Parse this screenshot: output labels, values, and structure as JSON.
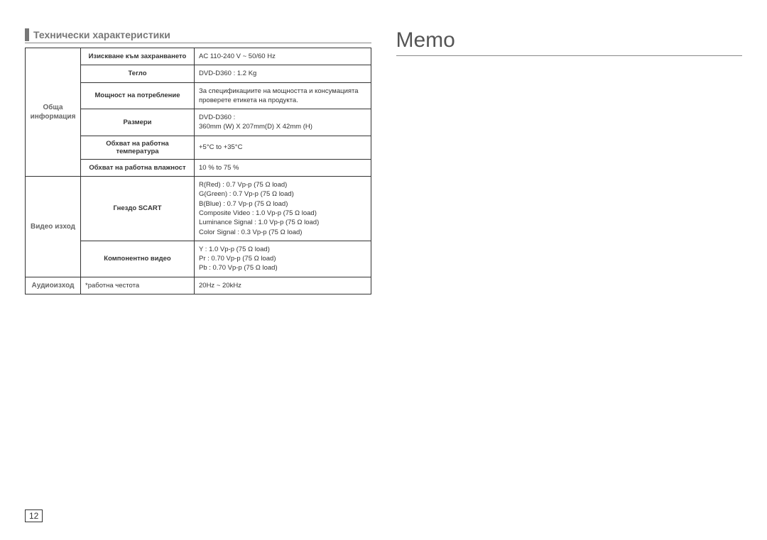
{
  "section_title": "Технически характеристики",
  "memo_title": "Memo",
  "page_number": "12",
  "groups": [
    {
      "head": "Обща информация",
      "rows": [
        {
          "label": "Изискване към захранването",
          "value": "AC 110-240 V ~ 50/60 Hz",
          "bold": true
        },
        {
          "label": "Тегло",
          "value": "DVD-D360 : 1.2 Kg",
          "bold": true
        },
        {
          "label": "Мощност на потребление",
          "value": "За спецификациите на мощността и консумацията проверете етикета на продукта.",
          "bold": true
        },
        {
          "label": "Размери",
          "value": "DVD-D360 :\n360mm (W) X 207mm(D) X 42mm (H)",
          "bold": true
        },
        {
          "label": "Обхват на работна температура",
          "value": "+5°C to +35°C",
          "bold": true
        },
        {
          "label": "Обхват на работна влажност",
          "value": "10 % to 75 %",
          "bold": true
        }
      ]
    },
    {
      "head": "Видео изход",
      "rows": [
        {
          "label": "Гнездо SCART",
          "value": "R(Red) : 0.7 Vp-p (75 Ω load)\nG(Green) : 0.7 Vp-p (75 Ω load)\nB(Blue) : 0.7 Vp-p (75 Ω load)\nComposite Video : 1.0 Vp-p (75 Ω load)\nLuminance Signal : 1.0 Vp-p (75 Ω load)\nColor Signal : 0.3 Vp-p (75 Ω load)",
          "bold": true
        },
        {
          "label": "Компонентно видео",
          "value": "Y : 1.0 Vp-p (75 Ω load)\nPr : 0.70 Vp-p (75 Ω load)\nPb : 0.70 Vp-p (75 Ω load)",
          "bold": true
        }
      ]
    },
    {
      "head": "Аудиоизход",
      "rows": [
        {
          "label": "*работна честота",
          "value": "20Hz ~ 20kHz",
          "bold": false
        }
      ]
    }
  ]
}
